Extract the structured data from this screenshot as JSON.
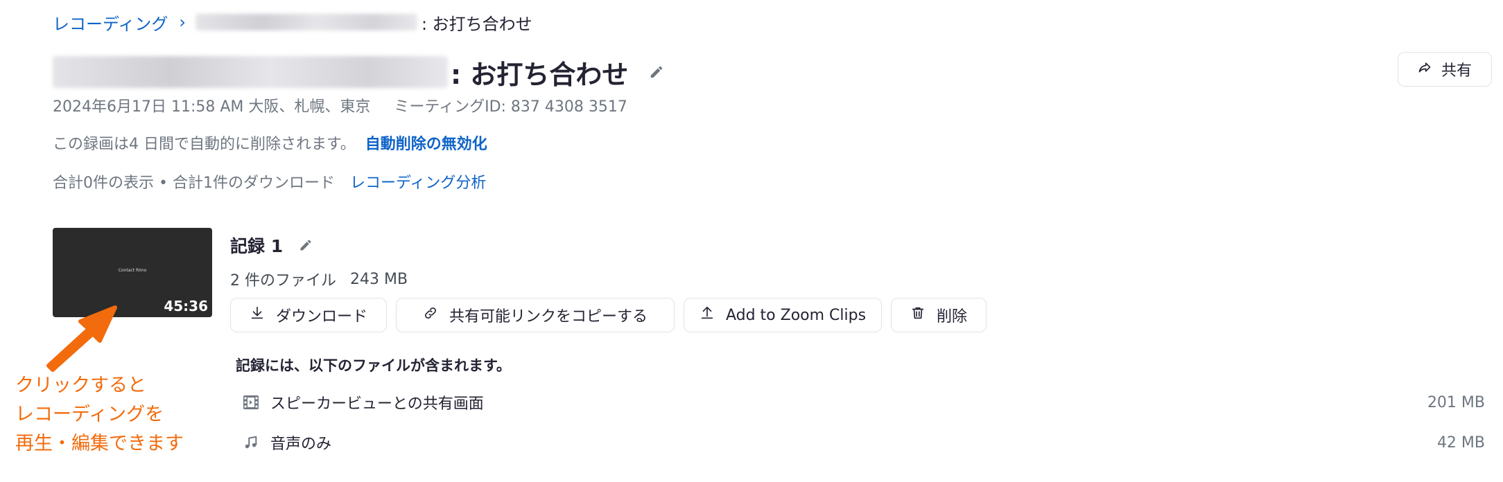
{
  "breadcrumb": {
    "root": "レコーディング",
    "separator": "›",
    "suffix": ": お打ち合わせ"
  },
  "title": {
    "suffix": ": お打ち合わせ"
  },
  "share_button": {
    "label": "共有"
  },
  "meta": {
    "datetime": "2024年6月17日 11:58 AM 大阪、札幌、東京",
    "meeting_id": "ミーティングID: 837 4308 3517"
  },
  "auto_delete": {
    "notice": "この録画は4 日間で自動的に削除されます。",
    "disable_link": "自動削除の無効化"
  },
  "stats": {
    "text": "合計0件の表示 • 合計1件のダウンロード",
    "analytics_link": "レコーディング分析"
  },
  "recording": {
    "thumbnail_caption": "Contact Rimo",
    "duration": "45:36",
    "title": "記録 1",
    "file_count": "2 件のファイル",
    "total_size": "243 MB",
    "actions": {
      "download": "ダウンロード",
      "copy_link": "共有可能リンクをコピーする",
      "zoom_clips": "Add to Zoom Clips",
      "delete": "削除"
    },
    "includes_heading": "記録には、以下のファイルが含まれます。",
    "files": [
      {
        "icon": "film-icon",
        "name": "スピーカービューとの共有画面",
        "size": "201 MB"
      },
      {
        "icon": "music-note-icon",
        "name": "音声のみ",
        "size": "42 MB"
      }
    ]
  },
  "annotation": {
    "lines": [
      "クリックすると",
      "レコーディングを",
      "再生・編集できます"
    ],
    "color": "#f26b0c"
  },
  "colors": {
    "link": "#0e63c7",
    "text": "#232333",
    "muted": "#6e7680",
    "border": "#dfe3e8"
  }
}
